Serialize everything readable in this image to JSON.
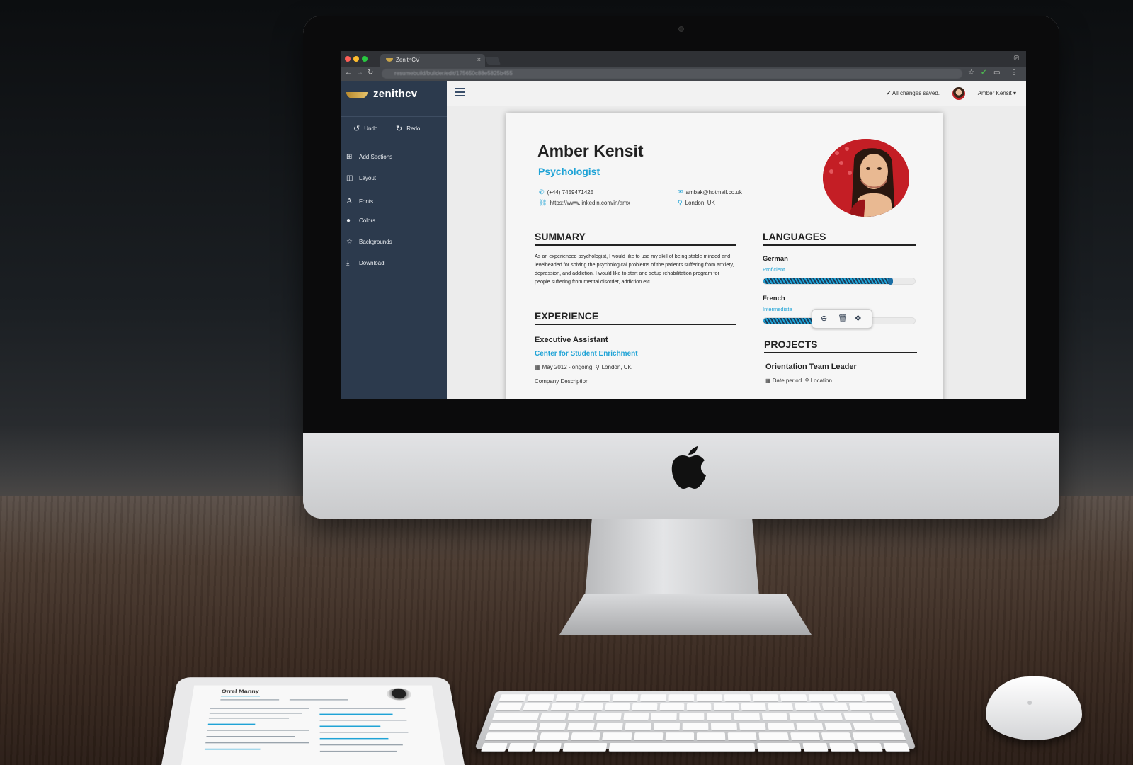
{
  "browser": {
    "tab_title": "ZenithCV",
    "tab_close": "×",
    "url_masked": "resumebuild/builder/edit/175650c88e5825b455"
  },
  "app": {
    "logo_text": "zenithcv",
    "undo_label": "Undo",
    "redo_label": "Redo",
    "sidebar_items": [
      {
        "label": "Add Sections",
        "icon": "plus-square-icon"
      },
      {
        "label": "Layout",
        "icon": "layout-icon"
      },
      {
        "label": "Fonts",
        "icon": "font-icon"
      },
      {
        "label": "Colors",
        "icon": "drop-icon"
      },
      {
        "label": "Backgrounds",
        "icon": "star-icon"
      },
      {
        "label": "Download",
        "icon": "download-icon"
      }
    ],
    "save_status": "All changes saved.",
    "user_name": "Amber Kensit"
  },
  "resume": {
    "name": "Amber Kensit",
    "title": "Psychologist",
    "phone": "(+44) 7459471425",
    "email": "ambak@hotmail.co.uk",
    "website": "https://www.linkedin.com/in/amx",
    "location": "London, UK",
    "summary_heading": "SUMMARY",
    "summary_text": "As an experienced psychologist, I would like to use my skill of being stable minded and levelheaded for solving the psychological problems of the patients suffering from anxiety, depression, and addiction. I would like to start and setup rehabilitation program for people suffering from mental disorder, addiction etc",
    "experience_heading": "EXPERIENCE",
    "job": {
      "title": "Executive Assistant",
      "company": "Center for Student Enrichment",
      "period": "May 2012 - ongoing",
      "location": "London, UK",
      "description": "Company Description"
    },
    "languages_heading": "LANGUAGES",
    "languages": [
      {
        "name": "German",
        "level": "Proficient",
        "fill": 0.85
      },
      {
        "name": "French",
        "level": "Intermediate",
        "fill": 0.45
      }
    ],
    "projects_heading": "PROJECTS",
    "project": {
      "title": "Orientation Team Leader",
      "period": "Date period",
      "location": "Location"
    }
  },
  "ipad_resume": {
    "name": "Orrel Manny"
  },
  "colors": {
    "accent": "#1fa3d6",
    "sidebar": "#2c3a4d",
    "photo_bg": "#c41e25"
  }
}
